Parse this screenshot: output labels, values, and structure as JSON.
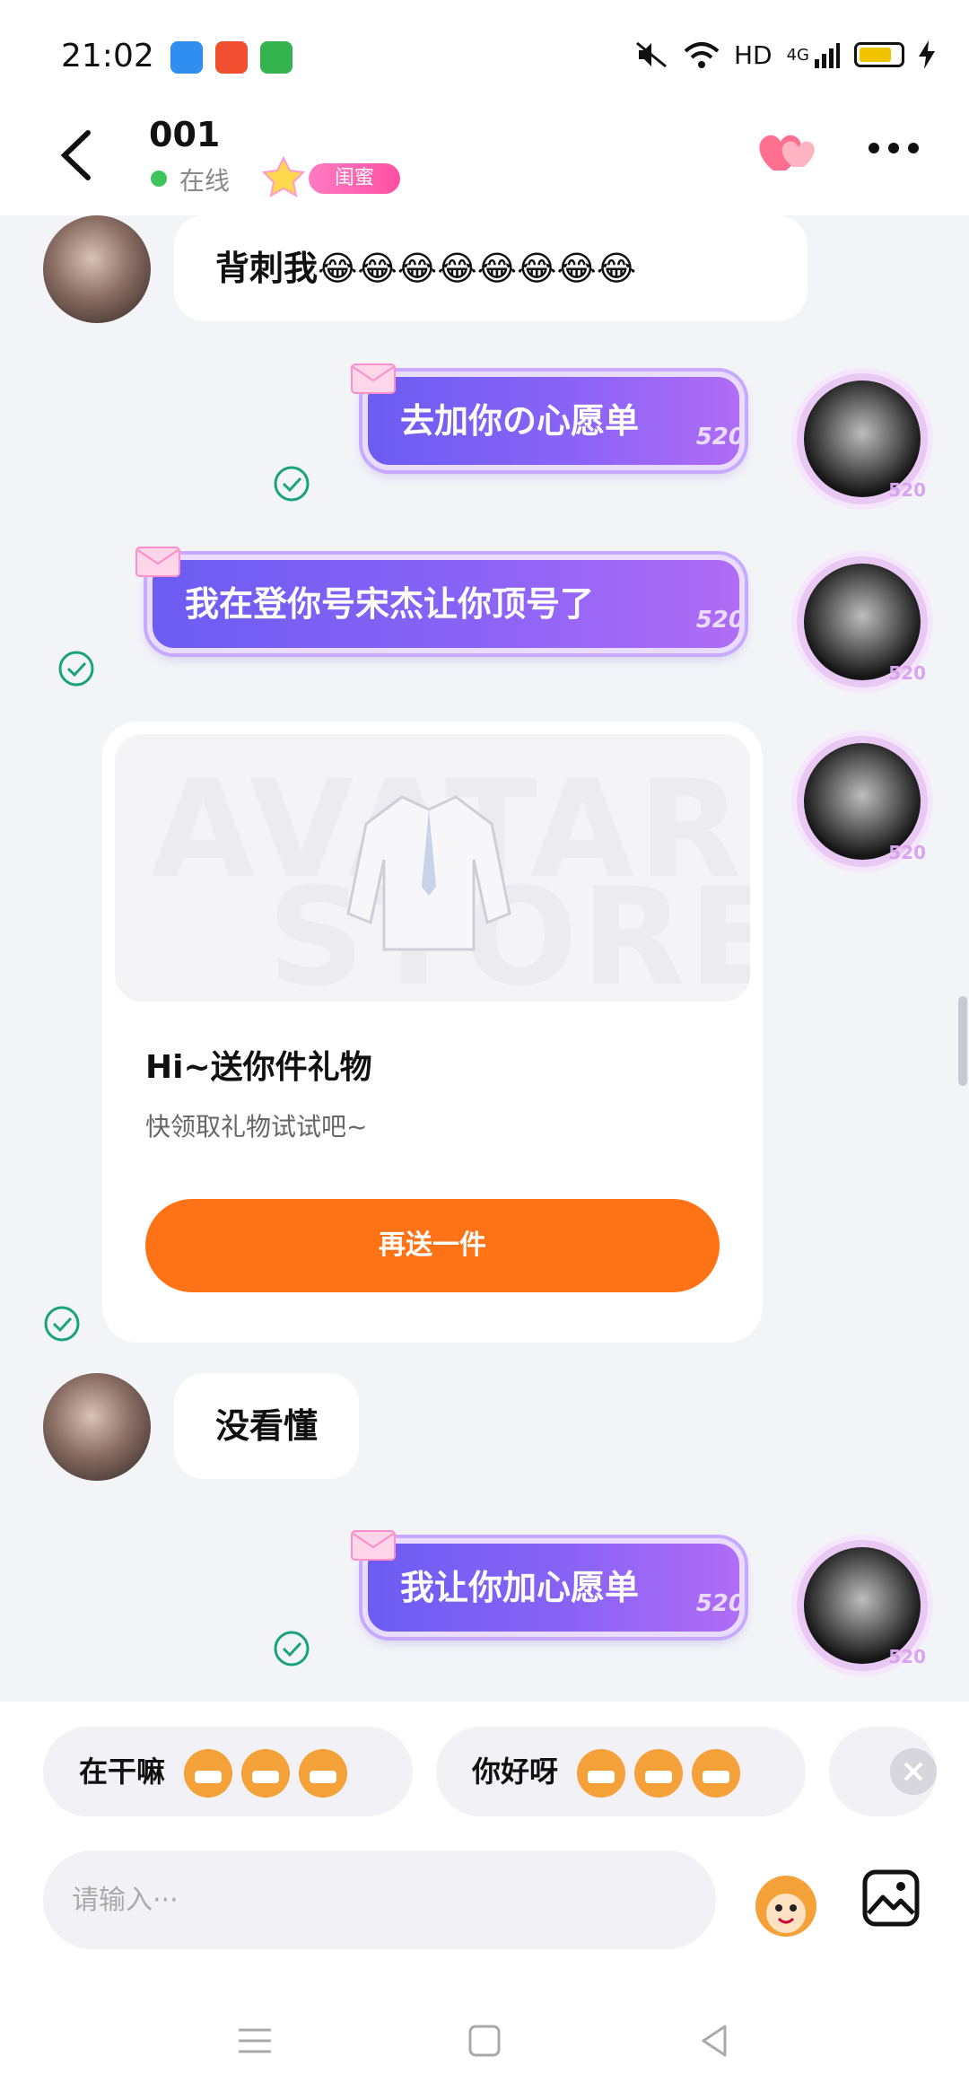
{
  "status_bar": {
    "time": "21:02",
    "network": "HD",
    "cell": "4G",
    "battery_level": 0.7
  },
  "header": {
    "name": "001",
    "status": "在线",
    "badge": "闺蜜"
  },
  "messages": {
    "m1": "背刺我😂😂😂😂😂😂😂😂",
    "m2": "去加你の心愿单",
    "m3": "我在登你号宋杰让你顶号了",
    "gift": {
      "title": "Hi~送你件礼物",
      "subtitle": "快领取礼物试试吧~",
      "button": "再送一件",
      "watermark_top": "AVATAR",
      "watermark_bottom": "STORE"
    },
    "m4": "没看懂",
    "m5": "我让你加心愿单",
    "tag": "520"
  },
  "quick_replies": [
    {
      "label": "在干嘛"
    },
    {
      "label": "你好呀"
    }
  ],
  "input": {
    "placeholder": "请输入···"
  },
  "colors": {
    "accent_orange": "#ff7316",
    "bubble_purple": "#7a5cf4",
    "check_green": "#1aa37a"
  }
}
